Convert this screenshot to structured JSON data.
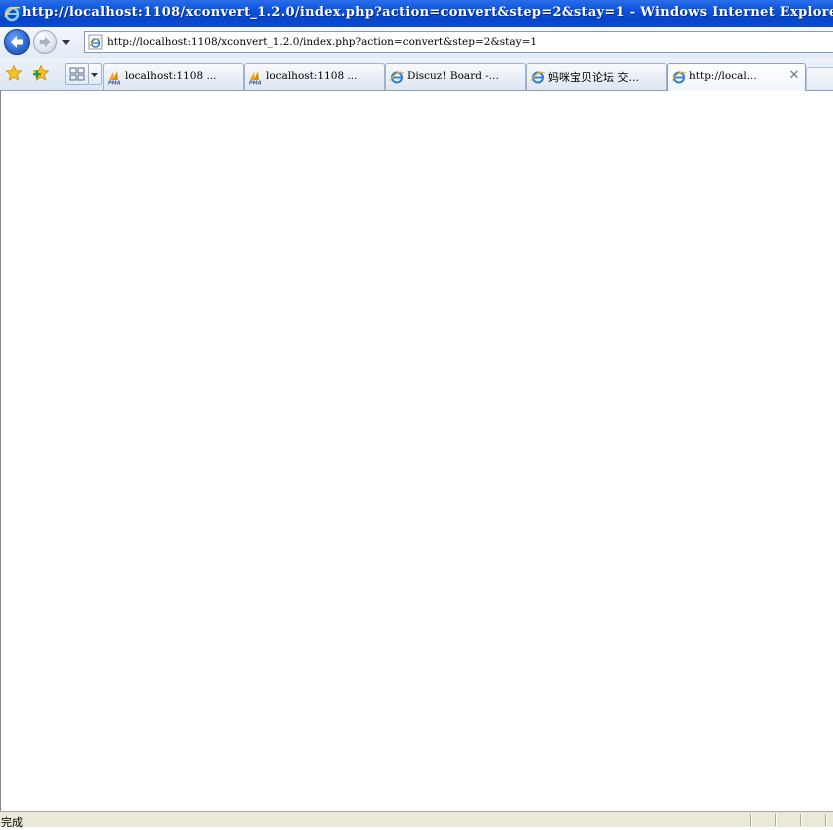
{
  "window": {
    "title": "http://localhost:1108/xconvert_1.2.0/index.php?action=convert&step=2&stay=1 - Windows Internet Explorer"
  },
  "address_bar": {
    "url": "http://localhost:1108/xconvert_1.2.0/index.php?action=convert&step=2&stay=1"
  },
  "tabs": [
    {
      "label": "localhost:1108 ...",
      "icon": "pma-icon"
    },
    {
      "label": "localhost:1108 ...",
      "icon": "pma-icon"
    },
    {
      "label": "Discuz! Board -...",
      "icon": "ie-page-icon"
    },
    {
      "label": "妈咪宝贝论坛 交...",
      "icon": "ie-page-icon"
    },
    {
      "label": "http://local...",
      "icon": "ie-page-icon",
      "active": true
    }
  ],
  "status_bar": {
    "text": "完成"
  },
  "colors": {
    "titlebar": "#0a4bd4",
    "statusbar": "#ece9d8"
  }
}
